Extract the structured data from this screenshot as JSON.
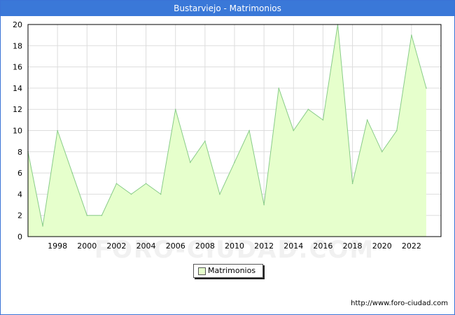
{
  "title": "Bustarviejo - Matrimonios",
  "source_url": "http://www.foro-ciudad.com",
  "watermark": "FORO-CIUDAD.COM",
  "colors": {
    "title_bg": "#3a78d8",
    "area_fill": "#e6ffcc",
    "line": "#88cc88",
    "grid": "#dddddd"
  },
  "chart_data": {
    "type": "area",
    "title": "Bustarviejo - Matrimonios",
    "x": [
      1996,
      1997,
      1998,
      1999,
      2000,
      2001,
      2002,
      2003,
      2004,
      2005,
      2006,
      2007,
      2008,
      2009,
      2010,
      2011,
      2012,
      2013,
      2014,
      2015,
      2016,
      2017,
      2018,
      2019,
      2020,
      2021,
      2022,
      2023
    ],
    "series": [
      {
        "name": "Matrimonios",
        "values": [
          8,
          1,
          10,
          6,
          2,
          2,
          5,
          4,
          5,
          4,
          12,
          7,
          9,
          4,
          7,
          10,
          3,
          14,
          10,
          12,
          11,
          20,
          5,
          11,
          8,
          10,
          19,
          14
        ]
      }
    ],
    "xticks": [
      "1998",
      "2000",
      "2002",
      "2004",
      "2006",
      "2008",
      "2010",
      "2012",
      "2014",
      "2016",
      "2018",
      "2020",
      "2022"
    ],
    "yticks": [
      "0",
      "2",
      "4",
      "6",
      "8",
      "10",
      "12",
      "14",
      "16",
      "18",
      "20"
    ],
    "ylim": [
      0,
      20
    ],
    "xlim": [
      1996,
      2024
    ],
    "grid": true,
    "legend_position": "bottom-center"
  }
}
